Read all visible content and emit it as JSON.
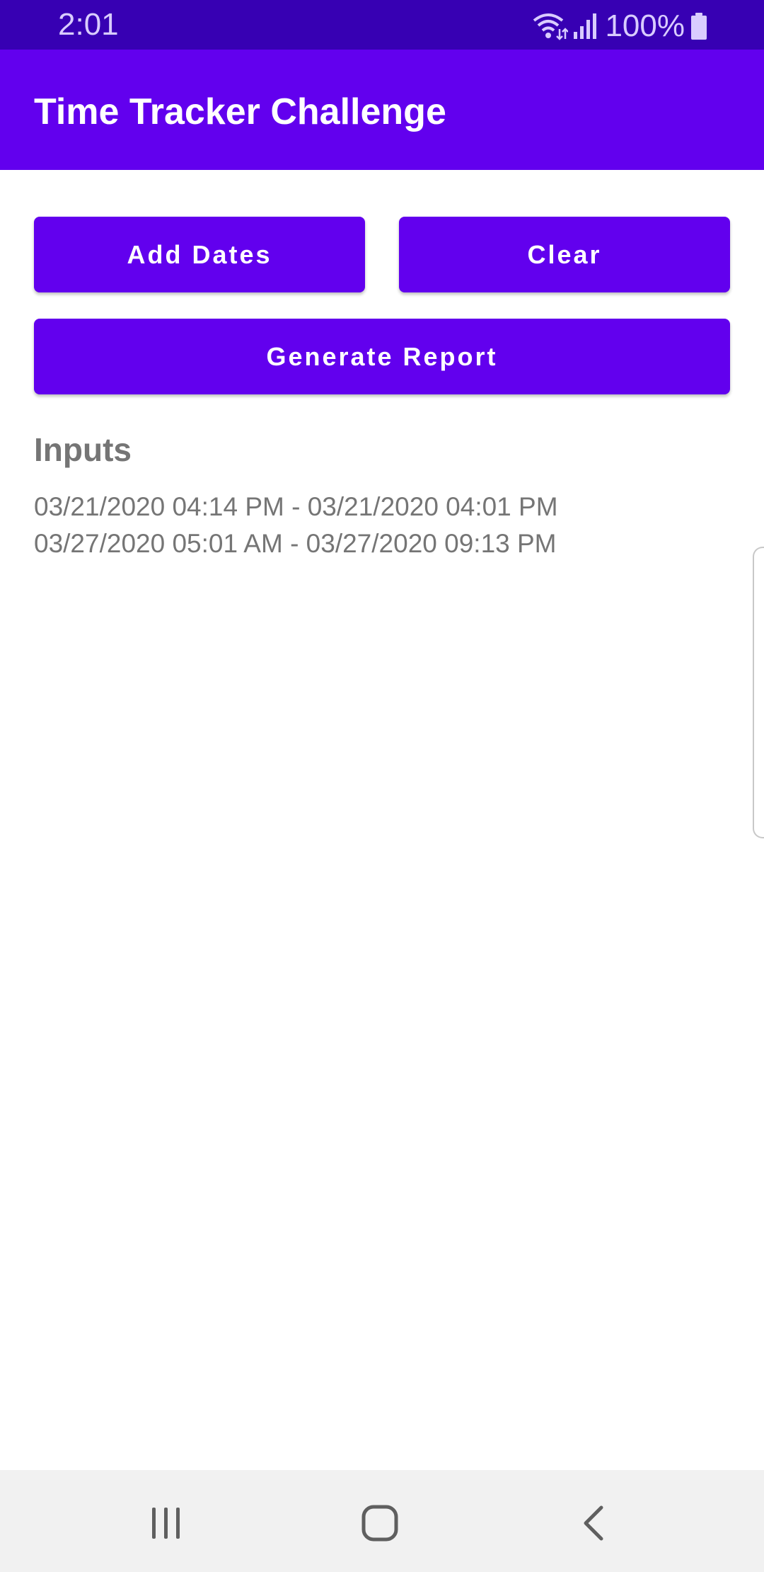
{
  "status_bar": {
    "time": "2:01",
    "battery_percent": "100%",
    "icons": [
      "wifi-icon",
      "signal-icon",
      "battery-icon"
    ]
  },
  "app_bar": {
    "title": "Time Tracker Challenge"
  },
  "buttons": {
    "add_dates": "Add Dates",
    "clear": "Clear",
    "generate_report": "Generate Report"
  },
  "inputs": {
    "heading": "Inputs",
    "entries": [
      "03/21/2020 04:14 PM - 03/21/2020 04:01 PM",
      "03/27/2020 05:01 AM - 03/27/2020 09:13 PM"
    ]
  },
  "nav_bar": {
    "icons": [
      "recents-icon",
      "home-icon",
      "back-icon"
    ]
  },
  "colors": {
    "status_bar": "#3700b3",
    "primary": "#6200ee",
    "text_secondary": "#757575",
    "nav_bar": "#f1f1f1"
  }
}
